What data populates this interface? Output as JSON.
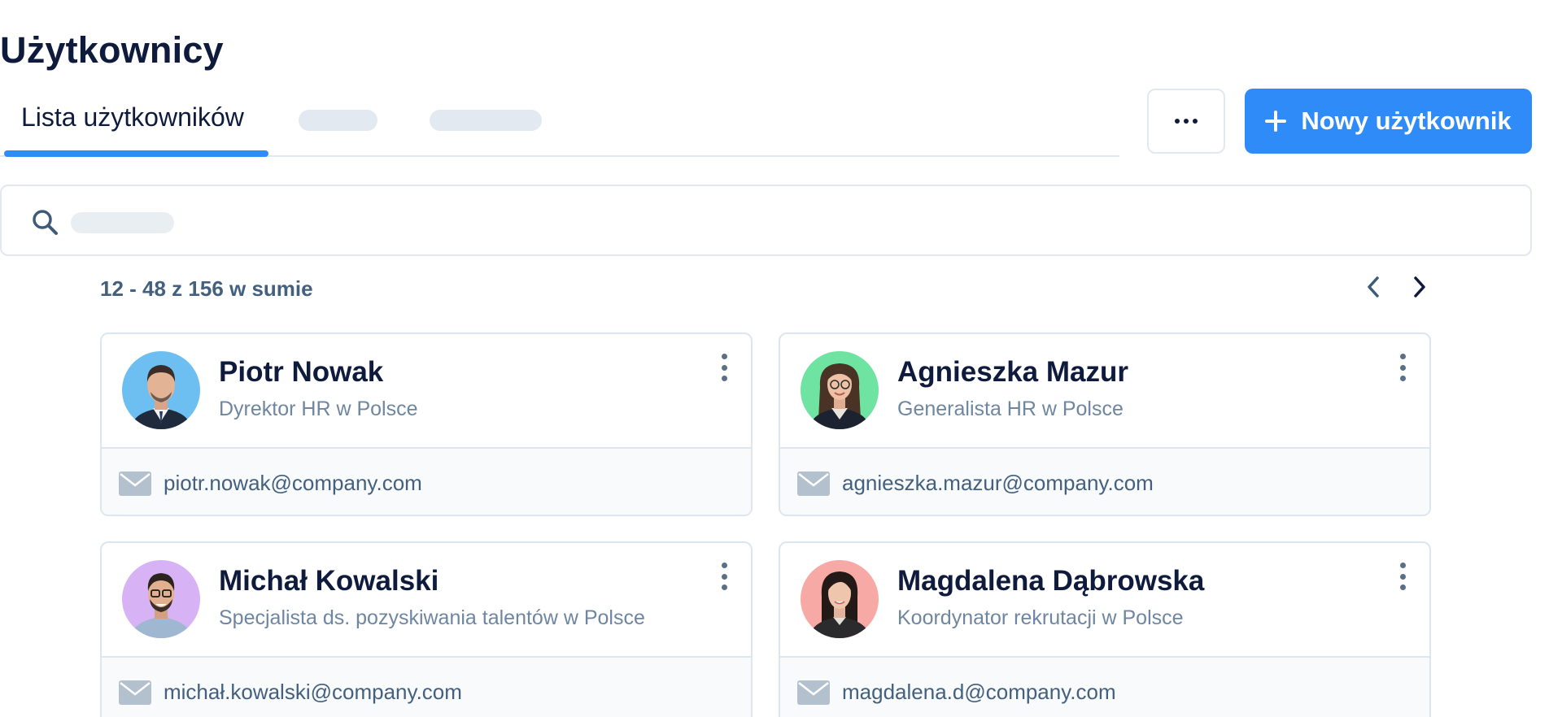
{
  "header": {
    "title": "Użytkownicy"
  },
  "tabs": [
    {
      "label": "Lista użytkowników",
      "active": true
    }
  ],
  "toolbar": {
    "more_icon": "more-horizontal-icon",
    "new_user_label": "Nowy użytkownik",
    "new_user_icon": "plus-icon",
    "accent_color": "#2f8bf7"
  },
  "search": {
    "icon": "search-icon"
  },
  "pagination": {
    "summary": "12 - 48 z 156 w sumie",
    "prev_icon": "chevron-left-icon",
    "next_icon": "chevron-right-icon"
  },
  "users": [
    {
      "name": "Piotr Nowak",
      "role": "Dyrektor HR w Polsce",
      "email": "piotr.nowak@company.com",
      "avatar_bg": "#6dbff2"
    },
    {
      "name": "Agnieszka Mazur",
      "role": "Generalista HR w Polsce",
      "email": "agnieszka.mazur@company.com",
      "avatar_bg": "#6fe3a2"
    },
    {
      "name": "Michał Kowalski",
      "role": "Specjalista ds. pozyskiwania talentów w Polsce",
      "email": "michał.kowalski@company.com",
      "avatar_bg": "#d7b3f5"
    },
    {
      "name": "Magdalena Dąbrowska",
      "role": "Koordynator rekrutacji w Polsce",
      "email": "magdalena.d@company.com",
      "avatar_bg": "#f7a9a6"
    }
  ]
}
